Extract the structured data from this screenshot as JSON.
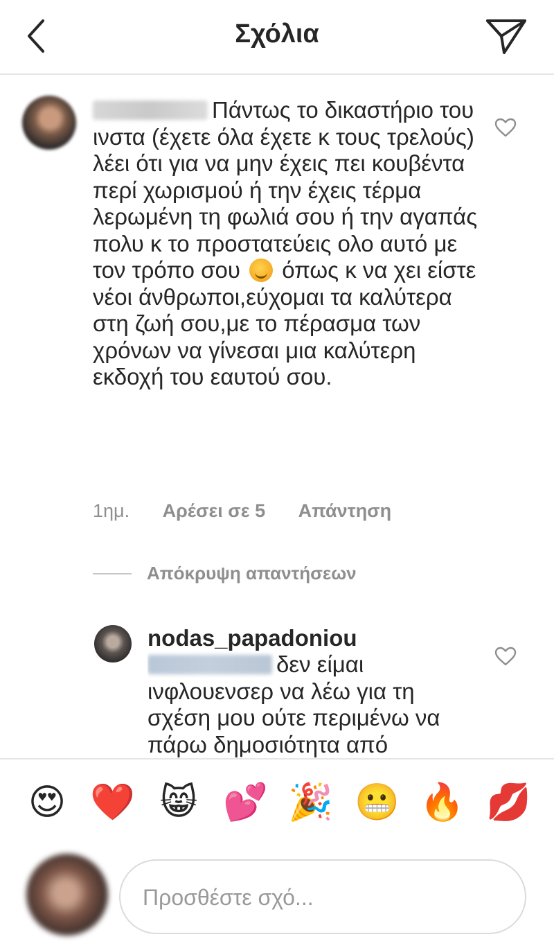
{
  "header": {
    "title": "Σχόλια",
    "back_icon": "chevron-left-icon",
    "send_icon": "paper-plane-icon"
  },
  "comment": {
    "text_before_emoji": "Πάντως το δικαστήριο του ινστα (έχετε όλα έχετε κ τους τρελούς) λέει ότι για να μην έχεις πει κουβέντα περί χωρισμού ή την έχεις τέρμα λερωμένη τη φωλιά σου ή την αγαπάς πολυ κ το προστατεύεις ολο αυτό με τον τρόπο σου",
    "emoji": "winking-face",
    "text_after_emoji": "όπως κ να χει είστε νέοι άνθρωποι,εύχομαι τα καλύτερα στη ζωή σου,με το πέρασμα των χρόνων να γίνεσαι μια καλύτερη εκδοχή του εαυτού σου.",
    "time": "1ημ.",
    "likes": "Αρέσει σε 5",
    "reply_label": "Απάντηση"
  },
  "hide_replies_label": "Απόκρυψη απαντήσεων",
  "reply": {
    "username": "nodas_papadoniou",
    "text": "δεν είμαι ινφλουενσερ να λέω για τη σχέση μου ούτε περιμένω να πάρω δημοσιότητα από"
  },
  "emoji_bar": [
    "😍",
    "❤️",
    "😸",
    "💕",
    "🎉",
    "😬",
    "🔥",
    "💋"
  ],
  "input": {
    "placeholder": "Προσθέστε σχό..."
  },
  "colors": {
    "text": "#262626",
    "secondary": "#8e8e8e",
    "divider": "#e6e6e6"
  }
}
